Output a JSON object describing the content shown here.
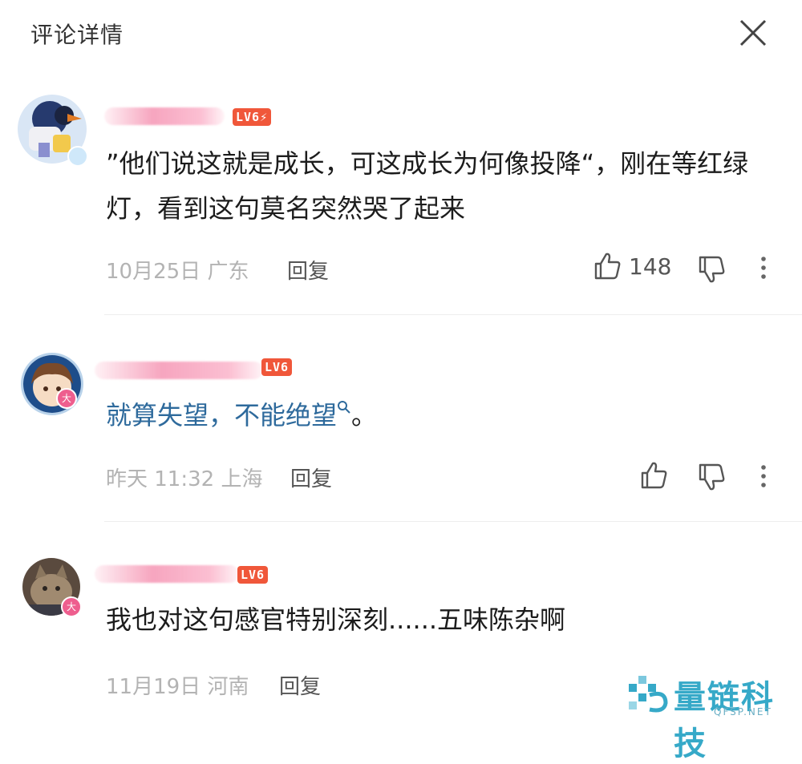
{
  "header": {
    "title": "评论详情"
  },
  "comments": [
    {
      "level": "LV6",
      "text": "”他们说这就是成长，可这成长为何像投降“，刚在等红绿灯，看到这句莫名突然哭了起来",
      "date": "10月25日",
      "location": "广东",
      "reply_label": "回复",
      "likes": "148"
    },
    {
      "level": "LV6",
      "text": "就算失望，不能绝望",
      "text_suffix": "。",
      "date": "昨天 11:32",
      "location": "上海",
      "reply_label": "回复",
      "badge": "大"
    },
    {
      "level": "LV6",
      "text": "我也对这句感官特别深刻......五味陈杂啊",
      "date": "11月19日",
      "location": "河南",
      "reply_label": "回复",
      "badge": "大"
    }
  ],
  "icons": {
    "close": "close-icon",
    "like": "thumbs-up-icon",
    "dislike": "thumbs-down-icon",
    "more": "more-vertical-icon",
    "search": "search-icon"
  },
  "watermark": {
    "name": "量链科技",
    "url": "QFSP.NET"
  },
  "colors": {
    "level_badge": "#f0573a",
    "link_text": "#2e6a9c",
    "watermark": "#36a9c8"
  }
}
